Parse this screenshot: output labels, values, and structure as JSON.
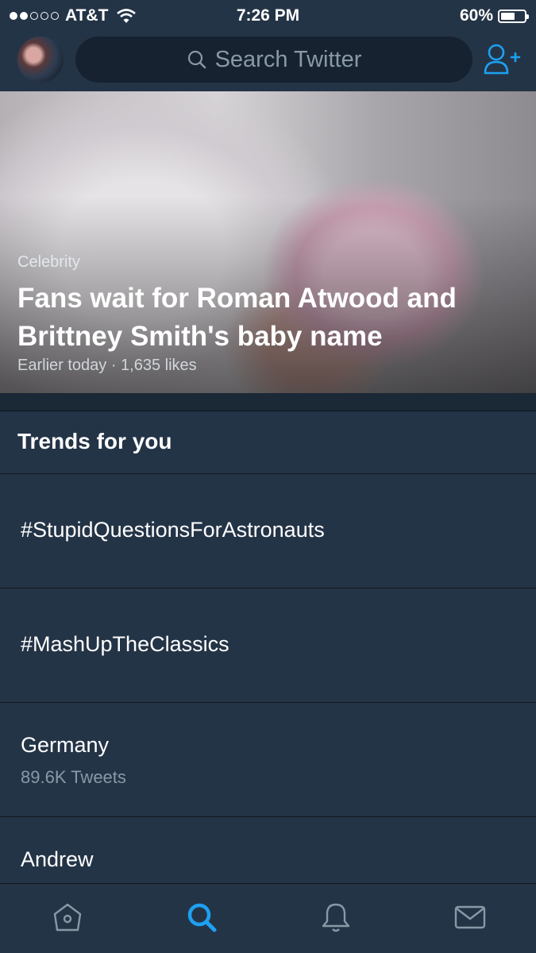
{
  "status_bar": {
    "carrier": "AT&T",
    "time": "7:26 PM",
    "battery": "60%",
    "battery_level": 0.6
  },
  "search": {
    "placeholder": "Search Twitter"
  },
  "featured": {
    "category": "Celebrity",
    "headline": "Fans wait for Roman Atwood and Brittney Smith's baby name",
    "meta": "Earlier today · 1,635 likes"
  },
  "trends": {
    "title": "Trends for you",
    "items": [
      {
        "name": "#StupidQuestionsForAstronauts",
        "count": ""
      },
      {
        "name": "#MashUpTheClassics",
        "count": ""
      },
      {
        "name": "Germany",
        "count": "89.6K Tweets"
      },
      {
        "name": "Andrew",
        "count": ""
      }
    ]
  },
  "tabs": [
    "home-icon",
    "search-icon",
    "notifications-icon",
    "messages-icon"
  ],
  "colors": {
    "accent": "#1da1f2",
    "background": "#243447",
    "muted": "#8899a6"
  }
}
